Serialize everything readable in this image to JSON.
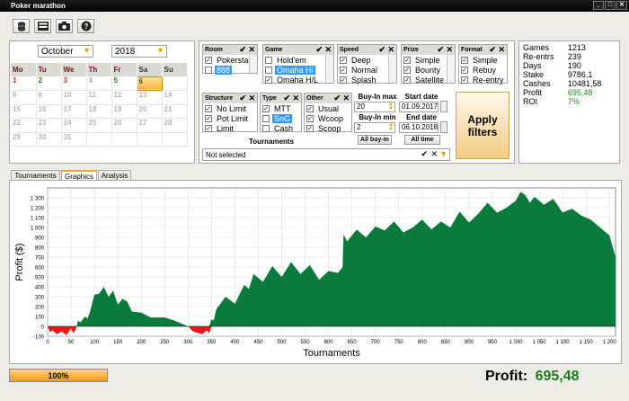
{
  "window": {
    "title": "Poker marathon"
  },
  "toolbar": {
    "icons": [
      "database-icon",
      "filter-icon",
      "camera-icon",
      "help-icon"
    ]
  },
  "calendar": {
    "month": "October",
    "year": "2018",
    "weekdays": [
      "Mo",
      "Tu",
      "We",
      "Th",
      "Fr",
      "Sa",
      "Su"
    ],
    "weeks": [
      [
        "1",
        "2",
        "3",
        "4",
        "5",
        "6",
        ""
      ],
      [
        "8",
        "9",
        "10",
        "11",
        "12",
        "13",
        "14"
      ],
      [
        "15",
        "16",
        "17",
        "18",
        "19",
        "20",
        "21"
      ],
      [
        "22",
        "23",
        "24",
        "25",
        "26",
        "27",
        "28"
      ],
      [
        "29",
        "30",
        "31",
        "",
        "",
        "",
        ""
      ]
    ],
    "selected": "6"
  },
  "filters": {
    "room": {
      "title": "Room",
      "items": [
        {
          "label": "Pokerstars",
          "checked": true,
          "sel": false
        },
        {
          "label": "888",
          "checked": false,
          "sel": true
        }
      ]
    },
    "game": {
      "title": "Game",
      "items": [
        {
          "label": "Hold'em",
          "checked": false,
          "sel": false
        },
        {
          "label": "Omaha Hi",
          "checked": false,
          "sel": true
        },
        {
          "label": "Omaha H/L",
          "checked": true,
          "sel": false
        }
      ]
    },
    "speed": {
      "title": "Speed",
      "items": [
        {
          "label": "Deep",
          "checked": true,
          "sel": false
        },
        {
          "label": "Normal",
          "checked": true,
          "sel": false
        },
        {
          "label": "Splash",
          "checked": true,
          "sel": false
        }
      ]
    },
    "prize": {
      "title": "Prize",
      "items": [
        {
          "label": "Simple",
          "checked": true,
          "sel": false
        },
        {
          "label": "Bounty",
          "checked": true,
          "sel": false
        },
        {
          "label": "Satellite",
          "checked": true,
          "sel": false
        }
      ]
    },
    "format": {
      "title": "Format",
      "items": [
        {
          "label": "Simple",
          "checked": true,
          "sel": false
        },
        {
          "label": "Rebuy",
          "checked": true,
          "sel": false
        },
        {
          "label": "Re-entry",
          "checked": true,
          "sel": false
        }
      ]
    },
    "structure": {
      "title": "Structure",
      "items": [
        {
          "label": "No Limit",
          "checked": true,
          "sel": false
        },
        {
          "label": "Pot Limit",
          "checked": true,
          "sel": false
        },
        {
          "label": "Limit",
          "checked": true,
          "sel": false
        }
      ]
    },
    "type": {
      "title": "Type",
      "items": [
        {
          "label": "MTT",
          "checked": true,
          "sel": false
        },
        {
          "label": "SnG",
          "checked": false,
          "sel": true
        },
        {
          "label": "Cash",
          "checked": false,
          "sel": false
        }
      ]
    },
    "other": {
      "title": "Other",
      "items": [
        {
          "label": "Usual",
          "checked": true,
          "sel": false
        },
        {
          "label": "Wcoop",
          "checked": true,
          "sel": false
        },
        {
          "label": "Scoop",
          "checked": true,
          "sel": false
        }
      ]
    },
    "buyin_max_label": "Buy-In max",
    "buyin_max": "20",
    "buyin_min_label": "Buy-In min",
    "buyin_min": "2",
    "all_buyin": "All buy-in",
    "start_date_label": "Start date",
    "start_date": "01.09.2017",
    "end_date_label": "End date",
    "end_date": "06.10.2018",
    "all_time": "All time",
    "apply": "Apply filters",
    "tournaments_label": "Tournaments",
    "tournaments_value": "Not selected"
  },
  "stats": [
    {
      "k": "Games",
      "v": "1213",
      "c": "#000"
    },
    {
      "k": "Re-entrs",
      "v": "239",
      "c": "#000"
    },
    {
      "k": "Days",
      "v": "190",
      "c": "#000"
    },
    {
      "k": "Stake",
      "v": "9786,1",
      "c": "#000"
    },
    {
      "k": "Cashes",
      "v": "10481,58",
      "c": "#000"
    },
    {
      "k": "Profit",
      "v": "695,48",
      "c": "#1f8a1f"
    },
    {
      "k": "ROI",
      "v": "7%",
      "c": "#1f8a1f"
    }
  ],
  "tabs": [
    "Tournaments",
    "Graphics",
    "Analysis"
  ],
  "active_tab": "Graphics",
  "chart_data": {
    "type": "area",
    "xlabel": "Tournaments",
    "ylabel": "Profit ($)",
    "xlim": [
      0,
      1213
    ],
    "ylim": [
      -100,
      1400
    ],
    "xticks": [
      0,
      50,
      100,
      150,
      200,
      250,
      300,
      350,
      400,
      450,
      500,
      550,
      600,
      650,
      700,
      750,
      800,
      850,
      900,
      950,
      1000,
      1050,
      1100,
      1150,
      1200
    ],
    "xticklabels": [
      "0",
      "50",
      "100",
      "150",
      "200",
      "250",
      "300",
      "350",
      "400",
      "450",
      "500",
      "550",
      "600",
      "650",
      "700",
      "750",
      "800",
      "850",
      "900",
      "950",
      "1 000",
      "1 050",
      "1 100",
      "1 150",
      "1 200"
    ],
    "yticks": [
      -100,
      0,
      100,
      200,
      300,
      400,
      500,
      600,
      700,
      800,
      900,
      1000,
      1100,
      1200,
      1300
    ],
    "yticklabels": [
      "-100",
      "0",
      "100",
      "200",
      "300",
      "400",
      "500",
      "600",
      "700",
      "800",
      "900",
      "1 000",
      "1 100",
      "1 200",
      "1 300"
    ],
    "positive_color": "#0b7a3d",
    "negative_color": "#e8151b",
    "grid": true,
    "series": [
      {
        "x": [
          0,
          5,
          10,
          20,
          30,
          40,
          50,
          55,
          60,
          62,
          65,
          70,
          80,
          85,
          90,
          100,
          110,
          120,
          130,
          140,
          150,
          160,
          170,
          180,
          200,
          220,
          250,
          270,
          290,
          300,
          310,
          330,
          340,
          345,
          350,
          355,
          360,
          380,
          400,
          420,
          430,
          440,
          460,
          480,
          500,
          520,
          540,
          560,
          580,
          600,
          620,
          630,
          632,
          640,
          660,
          680,
          700,
          720,
          740,
          760,
          780,
          800,
          820,
          840,
          860,
          880,
          900,
          920,
          940,
          960,
          980,
          1000,
          1010,
          1020,
          1030,
          1040,
          1060,
          1080,
          1100,
          1120,
          1140,
          1160,
          1180,
          1200,
          1213
        ],
        "y": [
          0,
          -60,
          -40,
          -80,
          -50,
          -90,
          -20,
          -70,
          -30,
          0,
          60,
          40,
          100,
          80,
          140,
          320,
          330,
          400,
          300,
          360,
          220,
          280,
          250,
          150,
          140,
          90,
          90,
          60,
          20,
          0,
          -50,
          -80,
          -40,
          -70,
          70,
          60,
          170,
          300,
          230,
          420,
          380,
          530,
          450,
          610,
          500,
          650,
          530,
          620,
          470,
          560,
          540,
          600,
          930,
          860,
          980,
          900,
          1010,
          970,
          1060,
          950,
          1000,
          1080,
          980,
          1060,
          1000,
          1160,
          1050,
          1140,
          1250,
          1150,
          1200,
          1270,
          1360,
          1330,
          1250,
          1310,
          1230,
          1290,
          1150,
          1190,
          1120,
          1080,
          1000,
          920,
          700
        ]
      }
    ]
  },
  "progress": {
    "label": "100%",
    "value": 1.0
  },
  "profit_footer": {
    "label": "Profit:",
    "value": "695,48"
  }
}
